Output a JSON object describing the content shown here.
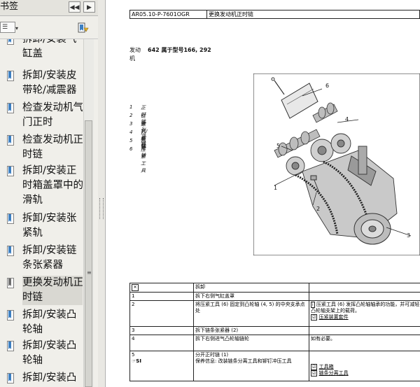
{
  "panel": {
    "title": "书签",
    "nav_prev_glyph": "◀◀",
    "nav_next_glyph": "▶",
    "options_glyph": "☰",
    "options_arrow": "▾",
    "bookmarks": [
      {
        "label": "拆卸/安装气缸盖",
        "selected": false
      },
      {
        "label": "拆卸/安装皮带轮/减震器",
        "selected": false
      },
      {
        "label": "检查发动机气门正时",
        "selected": false
      },
      {
        "label": "检查发动机正时链",
        "selected": false
      },
      {
        "label": "拆卸/安装正时箱盖罩中的滑轨",
        "selected": false
      },
      {
        "label": "拆卸/安装张紧轨",
        "selected": false
      },
      {
        "label": "拆卸/安装链条张紧器",
        "selected": false
      },
      {
        "label": "更换发动机正时链",
        "selected": true
      },
      {
        "label": "拆卸/安装凸轮轴",
        "selected": false
      },
      {
        "label": "拆卸/安装凸轮轴",
        "selected": false
      },
      {
        "label": "拆卸/安装凸",
        "selected": false
      }
    ]
  },
  "doc": {
    "doc_code": "AR05.10-P-7601OGR",
    "doc_title": "更换发动机正时链",
    "engine_label": "发动",
    "engine_label2": "机",
    "engine_desc": "642 属于型号166, 292",
    "legend": [
      {
        "num": "1",
        "text": "正时链"
      },
      {
        "num": "2",
        "text": "链条张紧器"
      },
      {
        "num": "3",
        "text": "螺钉/螺栓"
      },
      {
        "num": "4",
        "text": "凸轮轴"
      },
      {
        "num": "5",
        "text": "凸轮轴"
      },
      {
        "num": "6",
        "text": "压紧工具"
      }
    ],
    "diagram_tags": [
      "6",
      "4",
      "5",
      "1",
      "2",
      "3"
    ],
    "table": {
      "header_col2": "拆卸",
      "rows": [
        {
          "num": "1",
          "step": "拆下右侧气缸盖罩",
          "note": ""
        },
        {
          "num": "2",
          "step": "将压紧工具 (6) 固定到凸轮轴 (4, 5) 的中央支承点处",
          "note": "压紧工具 (6) 发挥凸轮轴轴承的功能，并可减轻凸轮轴支架上的载荷。",
          "note2": "压紧装置套件"
        },
        {
          "num": "3",
          "step": "拆下链条张紧器 (2)",
          "note": ""
        },
        {
          "num": "4",
          "step": "拆下右侧进气凸轮轴链轮",
          "note": "如有必要。"
        },
        {
          "num": "5",
          "num_sub": "SI",
          "step": "分开正时链 (1)",
          "step2": "保养信息: 改装链条分离工具和铆钉冲压工具",
          "note": "工具箱",
          "note2": "链条分离工具"
        }
      ]
    }
  },
  "colors": {
    "panel_bg": "#f0efea",
    "selected_bg": "#d9d8d2",
    "bookmark_icon": "#3d7fc1"
  }
}
